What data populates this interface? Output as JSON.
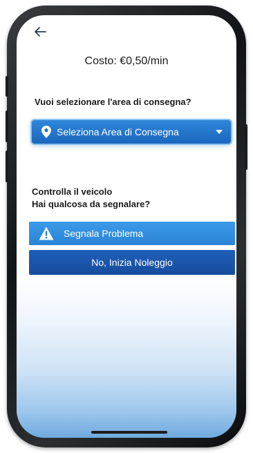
{
  "header": {
    "back_icon": "arrow-left-icon"
  },
  "pricing": {
    "cost_label": "Costo: €0,50/min"
  },
  "delivery": {
    "question": "Vuoi selezionare l'area di consegna?",
    "select_label": "Seleziona Area di Consegna",
    "select_icon": "map-pin-icon",
    "caret_icon": "chevron-down-icon"
  },
  "vehicle_check": {
    "title": "Controlla il veicolo",
    "subtitle": "Hai qualcosa da segnalare?",
    "report_button_label": "Segnala Problema",
    "report_icon": "warning-icon",
    "start_button_label": "No, Inizia Noleggio"
  },
  "colors": {
    "accent": "#2a84d6",
    "primary_dark": "#164d9e",
    "text": "#1a1a1a"
  }
}
